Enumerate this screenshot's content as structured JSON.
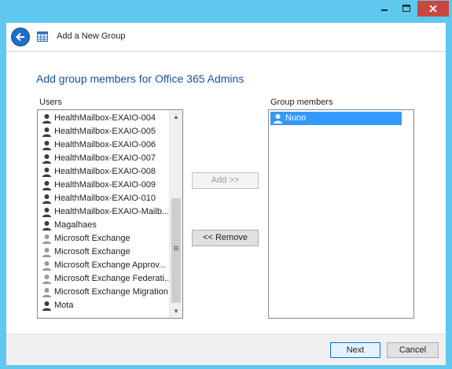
{
  "window": {
    "title_bar_controls": [
      "minimize",
      "maximize",
      "close"
    ]
  },
  "header": {
    "back_icon": "back-arrow-icon",
    "app_icon": "table-grid-icon",
    "title": "Add a New Group"
  },
  "page": {
    "heading": "Add group members for Office 365 Admins",
    "users_label": "Users",
    "members_label": "Group members"
  },
  "users": [
    {
      "name": "HealthMailbox-EXAIO-004",
      "icon": "user-icon-dark"
    },
    {
      "name": "HealthMailbox-EXAIO-005",
      "icon": "user-icon-dark"
    },
    {
      "name": "HealthMailbox-EXAIO-006",
      "icon": "user-icon-dark"
    },
    {
      "name": "HealthMailbox-EXAIO-007",
      "icon": "user-icon-dark"
    },
    {
      "name": "HealthMailbox-EXAIO-008",
      "icon": "user-icon-dark"
    },
    {
      "name": "HealthMailbox-EXAIO-009",
      "icon": "user-icon-dark"
    },
    {
      "name": "HealthMailbox-EXAIO-010",
      "icon": "user-icon-dark"
    },
    {
      "name": "HealthMailbox-EXAIO-Mailb...",
      "icon": "user-icon-dark"
    },
    {
      "name": "Magalhaes",
      "icon": "user-icon-dark"
    },
    {
      "name": "Microsoft Exchange",
      "icon": "user-icon-gray"
    },
    {
      "name": "Microsoft Exchange",
      "icon": "user-icon-gray"
    },
    {
      "name": "Microsoft Exchange Approv...",
      "icon": "user-icon-gray"
    },
    {
      "name": "Microsoft Exchange Federati...",
      "icon": "user-icon-gray"
    },
    {
      "name": "Microsoft Exchange Migration",
      "icon": "user-icon-gray"
    },
    {
      "name": "Mota",
      "icon": "user-icon-dark"
    }
  ],
  "members": [
    {
      "name": "Nuno",
      "icon": "user-icon-white",
      "selected": true
    }
  ],
  "buttons": {
    "add": "Add >>",
    "remove": "<< Remove",
    "next": "Next",
    "cancel": "Cancel"
  },
  "colors": {
    "window_border": "#5ec8ee",
    "heading": "#1c4fa3",
    "selection": "#3399ff",
    "close_button": "#c7483f"
  }
}
